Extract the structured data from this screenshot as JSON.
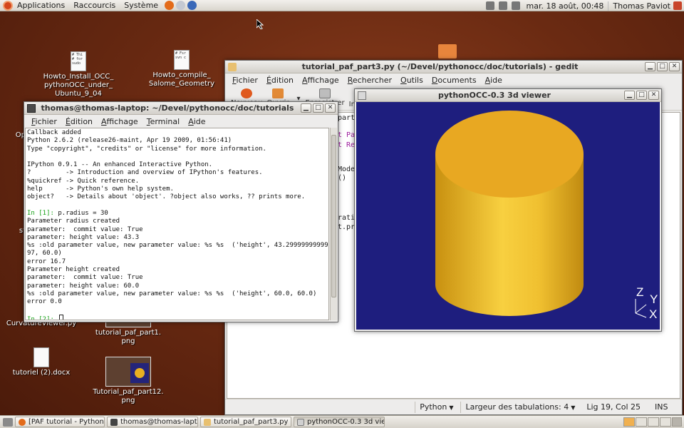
{
  "top_panel": {
    "menus": [
      "Applications",
      "Raccourcis",
      "Système"
    ],
    "clock": "mar. 18 août, 00:48",
    "user": "Thomas Paviot"
  },
  "desktop_icons": [
    {
      "label": "Howto_Install_OCC_\npythonOCC_under_\nUbuntu_9_04",
      "preview": "# Thi\n# for\nsudo"
    },
    {
      "label": "Howto_compile_\nSalome_Geometry",
      "preview": "# Fsr\nsvn c"
    },
    {
      "label": "CurvatureViewer.py"
    },
    {
      "label": "tutorial_paf_part1.\npng"
    },
    {
      "label": "tutoriel (2).docx"
    },
    {
      "label": "Tutorial_paf_part12.\npng"
    }
  ],
  "gedit": {
    "title": "tutorial_paf_part3.py (~/Devel/pythonocc/doc/tutorials) - gedit",
    "menus": [
      "Fichier",
      "Édition",
      "Affichage",
      "Rechercher",
      "Outils",
      "Documents",
      "Aide"
    ],
    "toolbar": [
      "Nouveau",
      "Ouvrir",
      "Enregistrer",
      "Im"
    ],
    "visible_code": [
      "part3",
      "t Pa",
      "t Re",
      "Mode",
      "()",
      "ratio",
      "t.pr"
    ],
    "status": {
      "language": "Python",
      "tab_width": "Largeur des tabulations: 4",
      "position": "Lig 19, Col 25",
      "mode": "INS"
    }
  },
  "terminal": {
    "title": "thomas@thomas-laptop: ~/Devel/pythonocc/doc/tutorials",
    "menus": [
      "Fichier",
      "Édition",
      "Affichage",
      "Terminal",
      "Aide"
    ],
    "lines": [
      "Callback added",
      "Python 2.6.2 (release26-maint, Apr 19 2009, 01:56:41)",
      "Type \"copyright\", \"credits\" or \"license\" for more information.",
      "",
      "IPython 0.9.1 -- An enhanced Interactive Python.",
      "?         -> Introduction and overview of IPython's features.",
      "%quickref -> Quick reference.",
      "help      -> Python's own help system.",
      "object?   -> Details about 'object'. ?object also works, ?? prints more.",
      "",
      "In [1]: p.radius = 30",
      "Parameter radius created",
      "parameter:  commit value: True",
      "parameter: height value: 43.3",
      "%s :old parameter value, new parameter value: %s %s  ('height', 43.2999999999999",
      "97, 60.0)",
      "error 16.7",
      "Parameter height created",
      "parameter:  commit value: True",
      "parameter: height value: 60.0",
      "%s :old parameter value, new parameter value: %s %s  ('height', 60.0, 60.0)",
      "error 0.0",
      "",
      "In [2]: "
    ],
    "prompt_lines": [
      10,
      23
    ]
  },
  "viewer": {
    "title": "pythonOCC-0.3 3d viewer",
    "axes": {
      "z": "Z",
      "y": "Y",
      "x": "X"
    },
    "colors": {
      "background": "#1e1e7e",
      "cylinder_top": "#e8a822",
      "cylinder_side_light": "#f8d040"
    }
  },
  "taskbar": {
    "tasks": [
      "[PAF tutorial - Python...",
      "thomas@thomas-lapt...",
      "tutorial_paf_part3.py ...",
      "pythonOCC-0.3 3d vie..."
    ]
  },
  "side_fragments": [
    "Op",
    "st"
  ]
}
